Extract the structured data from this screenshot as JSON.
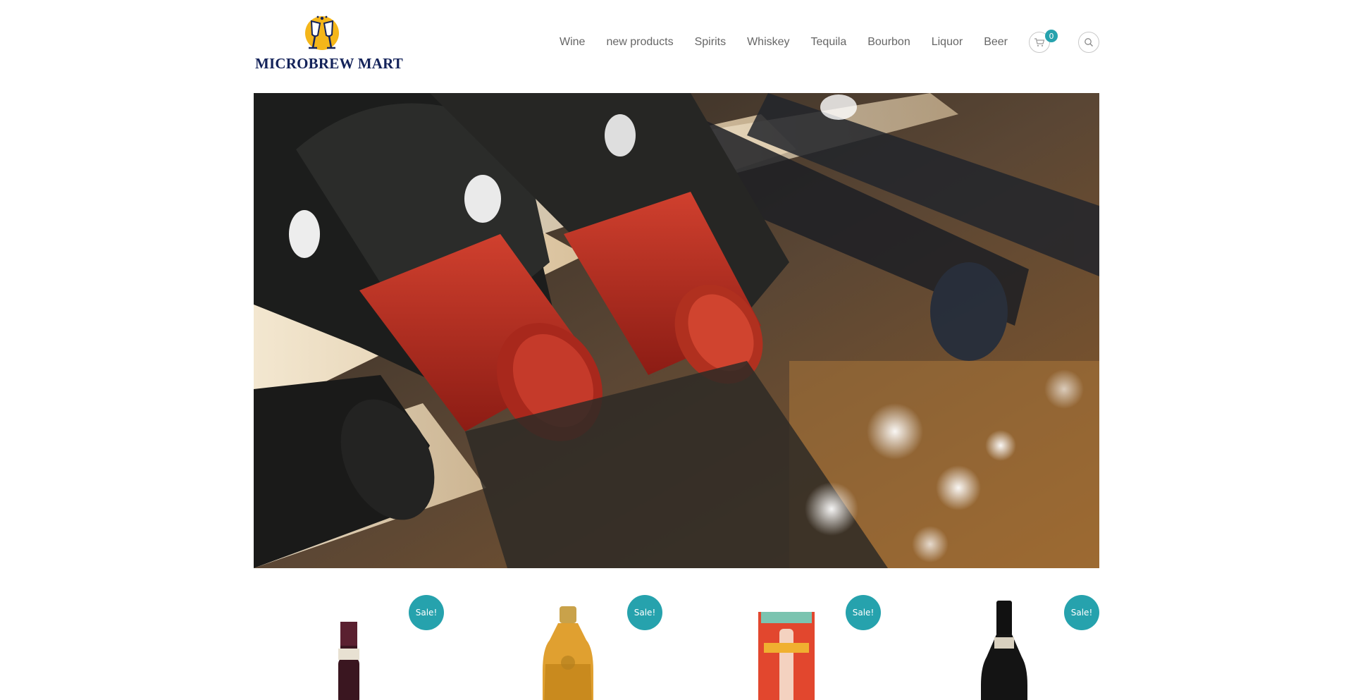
{
  "brand": {
    "name": "MICROBREW MART",
    "logo_icon": "glasses-toast-icon",
    "accent": "#26a2ad",
    "navy": "#14235a"
  },
  "nav": {
    "items": [
      "Wine",
      "new products",
      "Spirits",
      "Whiskey",
      "Tequila",
      "Bourbon",
      "Liquor",
      "Beer"
    ],
    "cart_count": "0",
    "cart_icon": "cart-icon",
    "search_icon": "search-icon"
  },
  "hero": {
    "image": "wine-bottles-rack-photo"
  },
  "products": [
    {
      "badge": "Sale!",
      "image": "red-wine-bottle"
    },
    {
      "badge": "Sale!",
      "image": "whisky-bottle"
    },
    {
      "badge": "Sale!",
      "image": "drink-now-bottle-box"
    },
    {
      "badge": "Sale!",
      "image": "dark-wine-bottle"
    }
  ]
}
